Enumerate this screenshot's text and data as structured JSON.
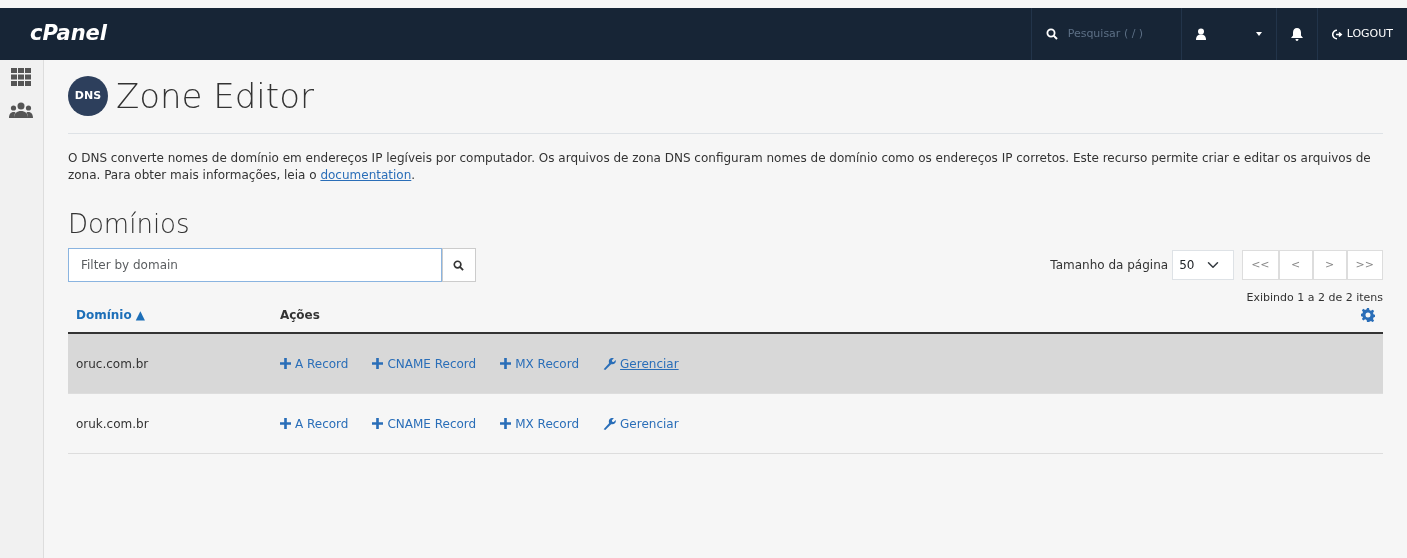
{
  "header": {
    "logo": "cPanel",
    "search": {
      "placeholder": "Pesquisar ( / )"
    },
    "logout": "LOGOUT"
  },
  "page": {
    "title": "Zone Editor",
    "icon_text": "DNS",
    "description": {
      "text": "O DNS converte nomes de domínio em endereços IP legíveis por computador. Os arquivos de zona DNS configuram nomes de domínio como os endereços IP corretos. Este recurso permite criar e editar os arquivos de zona. Para obter mais informações, leia o ",
      "link": "documentation",
      "end": "."
    }
  },
  "domains": {
    "heading": "Domínios",
    "filter": {
      "placeholder": "Filter by domain"
    },
    "page_size_label": "Tamanho da página",
    "page_size": "50",
    "pager": [
      "<<",
      "<",
      ">",
      ">>"
    ],
    "summary": "Exibindo 1 a 2 de 2 itens",
    "columns": [
      {
        "label": "Domínio ▲"
      },
      {
        "label": "Ações"
      }
    ],
    "rows": [
      {
        "domain": "oruc.com.br",
        "hovered": true,
        "actions": [
          {
            "kind": "add",
            "label": "A Record"
          },
          {
            "kind": "add",
            "label": "CNAME Record"
          },
          {
            "kind": "add",
            "label": "MX Record"
          },
          {
            "kind": "manage",
            "label": "Gerenciar"
          }
        ]
      },
      {
        "domain": "oruk.com.br",
        "hovered": false,
        "actions": [
          {
            "kind": "add",
            "label": "A Record"
          },
          {
            "kind": "add",
            "label": "CNAME Record"
          },
          {
            "kind": "add",
            "label": "MX Record"
          },
          {
            "kind": "manage",
            "label": "Gerenciar"
          }
        ]
      }
    ]
  }
}
